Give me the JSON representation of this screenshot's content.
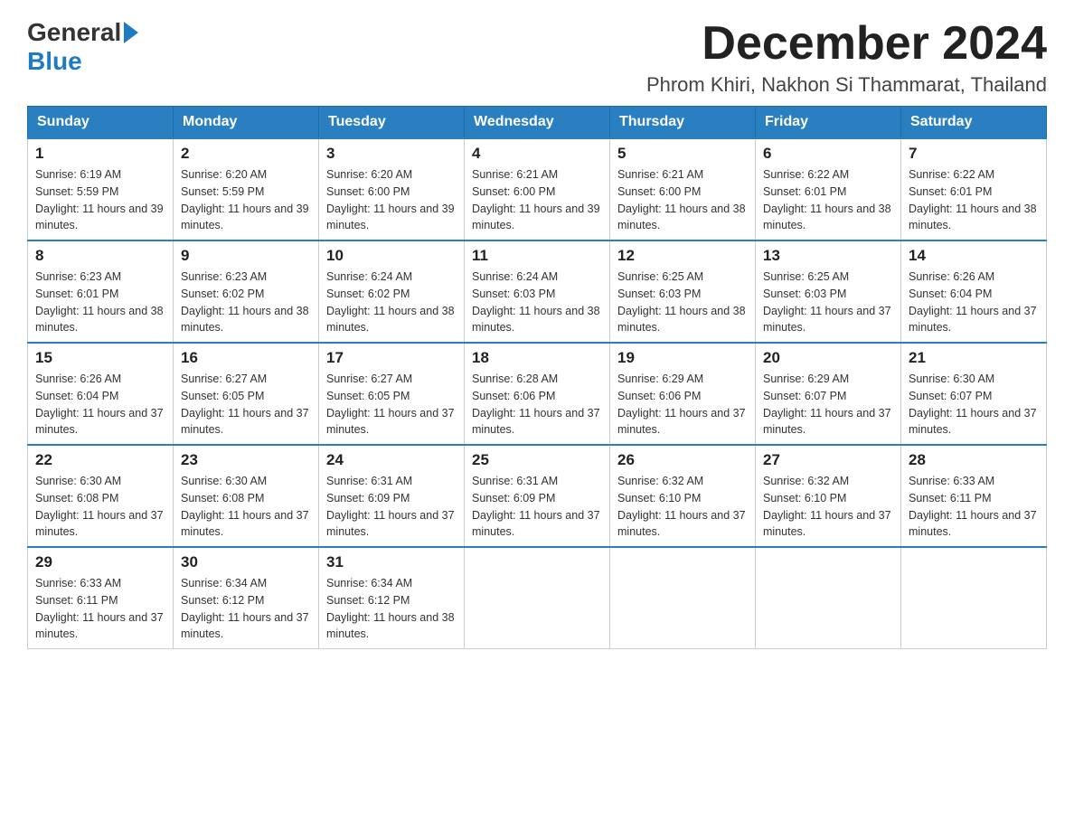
{
  "header": {
    "title": "December 2024",
    "subtitle": "Phrom Khiri, Nakhon Si Thammarat, Thailand",
    "logo_general": "General",
    "logo_blue": "Blue"
  },
  "days_of_week": [
    "Sunday",
    "Monday",
    "Tuesday",
    "Wednesday",
    "Thursday",
    "Friday",
    "Saturday"
  ],
  "weeks": [
    [
      {
        "day": "1",
        "sunrise": "6:19 AM",
        "sunset": "5:59 PM",
        "daylight": "11 hours and 39 minutes."
      },
      {
        "day": "2",
        "sunrise": "6:20 AM",
        "sunset": "5:59 PM",
        "daylight": "11 hours and 39 minutes."
      },
      {
        "day": "3",
        "sunrise": "6:20 AM",
        "sunset": "6:00 PM",
        "daylight": "11 hours and 39 minutes."
      },
      {
        "day": "4",
        "sunrise": "6:21 AM",
        "sunset": "6:00 PM",
        "daylight": "11 hours and 39 minutes."
      },
      {
        "day": "5",
        "sunrise": "6:21 AM",
        "sunset": "6:00 PM",
        "daylight": "11 hours and 38 minutes."
      },
      {
        "day": "6",
        "sunrise": "6:22 AM",
        "sunset": "6:01 PM",
        "daylight": "11 hours and 38 minutes."
      },
      {
        "day": "7",
        "sunrise": "6:22 AM",
        "sunset": "6:01 PM",
        "daylight": "11 hours and 38 minutes."
      }
    ],
    [
      {
        "day": "8",
        "sunrise": "6:23 AM",
        "sunset": "6:01 PM",
        "daylight": "11 hours and 38 minutes."
      },
      {
        "day": "9",
        "sunrise": "6:23 AM",
        "sunset": "6:02 PM",
        "daylight": "11 hours and 38 minutes."
      },
      {
        "day": "10",
        "sunrise": "6:24 AM",
        "sunset": "6:02 PM",
        "daylight": "11 hours and 38 minutes."
      },
      {
        "day": "11",
        "sunrise": "6:24 AM",
        "sunset": "6:03 PM",
        "daylight": "11 hours and 38 minutes."
      },
      {
        "day": "12",
        "sunrise": "6:25 AM",
        "sunset": "6:03 PM",
        "daylight": "11 hours and 38 minutes."
      },
      {
        "day": "13",
        "sunrise": "6:25 AM",
        "sunset": "6:03 PM",
        "daylight": "11 hours and 37 minutes."
      },
      {
        "day": "14",
        "sunrise": "6:26 AM",
        "sunset": "6:04 PM",
        "daylight": "11 hours and 37 minutes."
      }
    ],
    [
      {
        "day": "15",
        "sunrise": "6:26 AM",
        "sunset": "6:04 PM",
        "daylight": "11 hours and 37 minutes."
      },
      {
        "day": "16",
        "sunrise": "6:27 AM",
        "sunset": "6:05 PM",
        "daylight": "11 hours and 37 minutes."
      },
      {
        "day": "17",
        "sunrise": "6:27 AM",
        "sunset": "6:05 PM",
        "daylight": "11 hours and 37 minutes."
      },
      {
        "day": "18",
        "sunrise": "6:28 AM",
        "sunset": "6:06 PM",
        "daylight": "11 hours and 37 minutes."
      },
      {
        "day": "19",
        "sunrise": "6:29 AM",
        "sunset": "6:06 PM",
        "daylight": "11 hours and 37 minutes."
      },
      {
        "day": "20",
        "sunrise": "6:29 AM",
        "sunset": "6:07 PM",
        "daylight": "11 hours and 37 minutes."
      },
      {
        "day": "21",
        "sunrise": "6:30 AM",
        "sunset": "6:07 PM",
        "daylight": "11 hours and 37 minutes."
      }
    ],
    [
      {
        "day": "22",
        "sunrise": "6:30 AM",
        "sunset": "6:08 PM",
        "daylight": "11 hours and 37 minutes."
      },
      {
        "day": "23",
        "sunrise": "6:30 AM",
        "sunset": "6:08 PM",
        "daylight": "11 hours and 37 minutes."
      },
      {
        "day": "24",
        "sunrise": "6:31 AM",
        "sunset": "6:09 PM",
        "daylight": "11 hours and 37 minutes."
      },
      {
        "day": "25",
        "sunrise": "6:31 AM",
        "sunset": "6:09 PM",
        "daylight": "11 hours and 37 minutes."
      },
      {
        "day": "26",
        "sunrise": "6:32 AM",
        "sunset": "6:10 PM",
        "daylight": "11 hours and 37 minutes."
      },
      {
        "day": "27",
        "sunrise": "6:32 AM",
        "sunset": "6:10 PM",
        "daylight": "11 hours and 37 minutes."
      },
      {
        "day": "28",
        "sunrise": "6:33 AM",
        "sunset": "6:11 PM",
        "daylight": "11 hours and 37 minutes."
      }
    ],
    [
      {
        "day": "29",
        "sunrise": "6:33 AM",
        "sunset": "6:11 PM",
        "daylight": "11 hours and 37 minutes."
      },
      {
        "day": "30",
        "sunrise": "6:34 AM",
        "sunset": "6:12 PM",
        "daylight": "11 hours and 37 minutes."
      },
      {
        "day": "31",
        "sunrise": "6:34 AM",
        "sunset": "6:12 PM",
        "daylight": "11 hours and 38 minutes."
      },
      null,
      null,
      null,
      null
    ]
  ]
}
